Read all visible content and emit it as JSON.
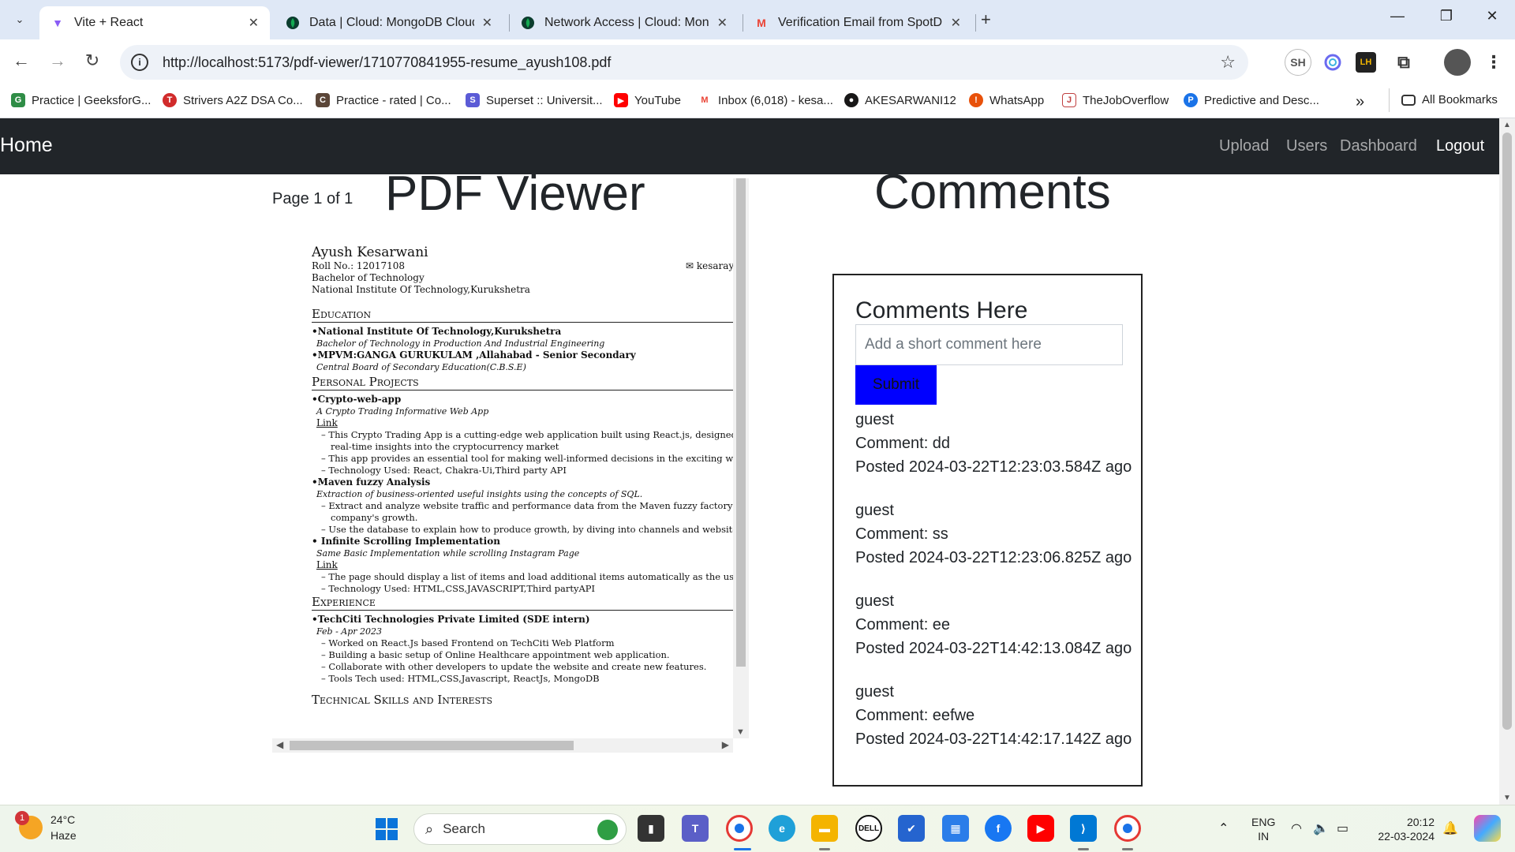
{
  "browser": {
    "tabs": [
      {
        "title": "Vite + React",
        "active": true
      },
      {
        "title": "Data | Cloud: MongoDB Cloud",
        "active": false
      },
      {
        "title": "Network Access | Cloud: Mongo",
        "active": false
      },
      {
        "title": "Verification Email from SpotDra",
        "active": false
      }
    ],
    "tab_close_glyph": "✕",
    "url": "http://localhost:5173/pdf-viewer/1710770841955-resume_ayush108.pdf",
    "profile_initials": "SH",
    "lh_badge": "LH",
    "bookmarks": [
      {
        "label": "Practice | GeeksforG...",
        "icon": "gfg-icon",
        "color": "#2f8d46"
      },
      {
        "label": "Strivers A2Z DSA Co...",
        "icon": "tuf-icon",
        "color": "#d12b2b"
      },
      {
        "label": "Practice - rated | Co...",
        "icon": "codechef-icon",
        "color": "#5b4638"
      },
      {
        "label": "Superset :: Universit...",
        "icon": "superset-icon",
        "color": "#5b5bd6"
      },
      {
        "label": "YouTube",
        "icon": "youtube-icon",
        "color": "#ff0000"
      },
      {
        "label": "Inbox (6,018) - kesa...",
        "icon": "gmail-icon",
        "color": "#ea4335"
      },
      {
        "label": "AKESARWANI12",
        "icon": "github-icon",
        "color": "#181717"
      },
      {
        "label": "WhatsApp",
        "icon": "whatsapp-icon",
        "color": "#e8510a"
      },
      {
        "label": "TheJobOverflow",
        "icon": "jobs-icon",
        "color": "#c04040"
      },
      {
        "label": "Predictive and Desc...",
        "icon": "predictive-icon",
        "color": "#1a73e8"
      }
    ],
    "all_bookmarks": "All Bookmarks"
  },
  "app": {
    "brand": "Home",
    "nav": [
      "Upload",
      "Users",
      "Dashboard"
    ],
    "logout": "Logout"
  },
  "pdf": {
    "pager": "Page 1 of 1",
    "title": "PDF Viewer",
    "resume": {
      "name": "Ayush Kesarwani",
      "roll": "Roll No.: 12017108",
      "degree": "Bachelor of Technology",
      "institute": "National Institute Of Technology,Kurukshetra",
      "email": "✉ kesaray",
      "education": "Education",
      "edu1": "•National Institute Of Technology,Kurukshetra",
      "edu1_sub": "Bachelor of Technology in Production And Industrial Engineering",
      "edu2": "•MPVM:GANGA GURUKULAM ,Allahabad - Senior Secondary",
      "edu2_sub": "Central Board of Secondary Education(C.B.S.E)",
      "projects": "Personal Projects",
      "p1": "•Crypto-web-app",
      "p1_sub": "A Crypto Trading Informative Web App",
      "p1_link": "Link",
      "p1_b1": "– This Crypto Trading App is a cutting-edge web application built using React.js, designed to",
      "p1_b1b": "real-time insights into the cryptocurrency market",
      "p1_b2": "– This app provides an essential tool for making well-informed decisions in the exciting world o",
      "p1_b3": "– Technology Used: React, Chakra-Ui,Third party API",
      "p2": "•Maven fuzzy Analysis",
      "p2_sub": "Extraction of business-oriented useful insights using the concepts of SQL.",
      "p2_b1": "– Extract and analyze website traffic and performance data from the Maven fuzzy factory datal",
      "p2_b1b": "company's growth.",
      "p2_b2": "– Use the database to explain how to produce growth, by diving into channels and website opti",
      "p3": "• Infinite Scrolling Implementation",
      "p3_sub": "Same Basic Implementation while scrolling Instagram Page",
      "p3_link": "Link",
      "p3_b1": "– The page should display a list of items and load additional items automatically as the user sc",
      "p3_b2": "– Technology Used: HTML,CSS,JAVASCRIPT,Third partyAPI",
      "experience": "Experience",
      "e1": "•TechCiti Technologies Private Limited (SDE intern)",
      "e1_sub": "Feb - Apr 2023",
      "e1_b1": "– Worked on React.Js based Frontend on TechCiti Web Platform",
      "e1_b2": "– Building a basic setup of Online Healthcare appointment web application.",
      "e1_b3": "– Collaborate with other developers to update the website and create new features.",
      "e1_b4": "– Tools Tech used: HTML,CSS,Javascript, ReactJs, MongoDB",
      "skills": "Technical Skills and Interests"
    }
  },
  "comments": {
    "title": "Comments",
    "card_title": "Comments Here",
    "placeholder": "Add a short comment here",
    "submit": "Submit",
    "items": [
      {
        "user": "guest",
        "comment": "Comment: dd",
        "posted": "Posted 2024-03-22T12:23:03.584Z ago"
      },
      {
        "user": "guest",
        "comment": "Comment: ss",
        "posted": "Posted 2024-03-22T12:23:06.825Z ago"
      },
      {
        "user": "guest",
        "comment": "Comment: ee",
        "posted": "Posted 2024-03-22T14:42:13.084Z ago"
      },
      {
        "user": "guest",
        "comment": "Comment: eefwe",
        "posted": "Posted 2024-03-22T14:42:17.142Z ago"
      }
    ]
  },
  "taskbar": {
    "weather_badge": "1",
    "temperature": "24°C",
    "condition": "Haze",
    "search": "Search",
    "lang1": "ENG",
    "lang2": "IN",
    "time": "20:12",
    "date": "22-03-2024"
  }
}
